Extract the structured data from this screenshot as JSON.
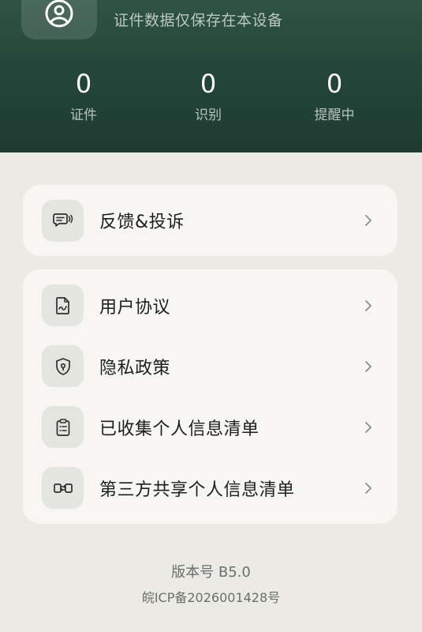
{
  "header": {
    "storage_note": "证件数据仅保存在本设备",
    "avatar_icon": "user-circle-icon",
    "background_color": "#24463a",
    "stats": [
      {
        "value": "0",
        "label": "证件"
      },
      {
        "value": "0",
        "label": "识别"
      },
      {
        "value": "0",
        "label": "提醒中"
      }
    ]
  },
  "menu": {
    "feedback": {
      "label": "反馈&投诉",
      "icon": "feedback-icon"
    },
    "items": [
      {
        "label": "用户协议",
        "icon": "document-icon"
      },
      {
        "label": "隐私政策",
        "icon": "shield-lock-icon"
      },
      {
        "label": "已收集个人信息清单",
        "icon": "clipboard-list-icon"
      },
      {
        "label": "第三方共享个人信息清单",
        "icon": "share-link-icon"
      }
    ]
  },
  "footer": {
    "version": "版本号 B5.0",
    "icp": "皖ICP备2026001428号"
  }
}
